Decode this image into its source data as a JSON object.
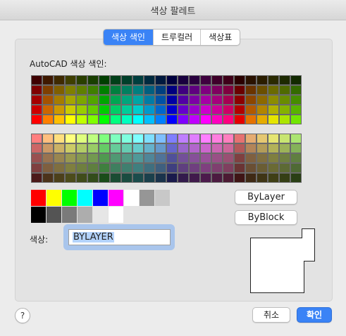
{
  "window": {
    "title": "색상 팔레트"
  },
  "tabs": [
    {
      "label": "색상 색인",
      "active": true
    },
    {
      "label": "트루컬러",
      "active": false
    },
    {
      "label": "색상표",
      "active": false
    }
  ],
  "palette": {
    "section_label": "AutoCAD 색상 색인:",
    "hue_rows": [
      [
        "#3f0000",
        "#3f1900",
        "#3f2a00",
        "#3f3f00",
        "#2a3f00",
        "#193f00",
        "#003f00",
        "#003f19",
        "#003f2a",
        "#003f3f",
        "#002a3f",
        "#00193f",
        "#00003f",
        "#19003f",
        "#2a003f",
        "#3f003f",
        "#3f002a",
        "#3f0019",
        "#2a0000",
        "#2a1200",
        "#2a1d00",
        "#2a2a00",
        "#1d2a00",
        "#122a00"
      ],
      [
        "#7f0000",
        "#7f3f00",
        "#7f5f00",
        "#7f7f00",
        "#5f7f00",
        "#3f7f00",
        "#007f00",
        "#007f3f",
        "#007f5f",
        "#007f7f",
        "#005f7f",
        "#003f7f",
        "#00007f",
        "#3f007f",
        "#5f007f",
        "#7f007f",
        "#7f005f",
        "#7f003f",
        "#6a0000",
        "#6a3400",
        "#6a4f00",
        "#6a6a00",
        "#4f6a00",
        "#346a00"
      ],
      [
        "#a50000",
        "#a55200",
        "#a57c00",
        "#a5a500",
        "#7ca500",
        "#52a500",
        "#00a500",
        "#00a552",
        "#00a57c",
        "#00a5a5",
        "#007ca5",
        "#0052a5",
        "#0000a5",
        "#5200a5",
        "#7c00a5",
        "#a500a5",
        "#a5007c",
        "#a50052",
        "#8c0000",
        "#8c4600",
        "#8c6900",
        "#8c8c00",
        "#698c00",
        "#468c00"
      ],
      [
        "#cc0000",
        "#cc6600",
        "#cc9900",
        "#cccc00",
        "#99cc00",
        "#66cc00",
        "#00cc00",
        "#00cc66",
        "#00cc99",
        "#00cccc",
        "#0099cc",
        "#0066cc",
        "#0000cc",
        "#6600cc",
        "#9900cc",
        "#cc00cc",
        "#cc0099",
        "#cc0066",
        "#b20000",
        "#b25900",
        "#b28500",
        "#b2b200",
        "#85b200",
        "#59b200"
      ],
      [
        "#ff0000",
        "#ff7f00",
        "#ffbf00",
        "#ffff00",
        "#bfff00",
        "#7fff00",
        "#00ff00",
        "#00ff7f",
        "#00ffbf",
        "#00ffff",
        "#00bfff",
        "#007fff",
        "#0000ff",
        "#7f00ff",
        "#bf00ff",
        "#ff00ff",
        "#ff00bf",
        "#ff007f",
        "#e50000",
        "#e57200",
        "#e5ac00",
        "#e5e500",
        "#ace500",
        "#72e500"
      ]
    ],
    "pastel_rows": [
      [
        "#ff7f7f",
        "#ffbf7f",
        "#ffdf7f",
        "#ffff7f",
        "#dfff7f",
        "#bfff7f",
        "#7fff7f",
        "#7fffbf",
        "#7fffdf",
        "#7fffff",
        "#7fdfff",
        "#7fbfff",
        "#7f7fff",
        "#bf7fff",
        "#df7fff",
        "#ff7fff",
        "#ff7fdf",
        "#ff7fbf",
        "#e57272",
        "#e5ac72",
        "#e5c872",
        "#e5e572",
        "#c8e572",
        "#ace572"
      ],
      [
        "#cc6666",
        "#cc9966",
        "#ccb266",
        "#cccc66",
        "#b2cc66",
        "#99cc66",
        "#66cc66",
        "#66cc99",
        "#66ccb2",
        "#66cccc",
        "#66b2cc",
        "#6699cc",
        "#6666cc",
        "#9966cc",
        "#b266cc",
        "#cc66cc",
        "#cc66b2",
        "#cc6699",
        "#b25959",
        "#b28559",
        "#b29c59",
        "#b2b259",
        "#9cb259",
        "#85b259"
      ],
      [
        "#995050",
        "#997350",
        "#998650",
        "#999950",
        "#869950",
        "#739950",
        "#509950",
        "#509973",
        "#509986",
        "#509999",
        "#508699",
        "#507399",
        "#505099",
        "#735099",
        "#865099",
        "#995099",
        "#995086",
        "#995073",
        "#7f4040",
        "#7f6040",
        "#7f6f40",
        "#7f7f40",
        "#6f7f40",
        "#607f40"
      ],
      [
        "#7f3f3f",
        "#7f5f3f",
        "#7f6f3f",
        "#7f7f3f",
        "#6f7f3f",
        "#5f7f3f",
        "#3f7f3f",
        "#3f7f5f",
        "#3f7f6f",
        "#3f7f7f",
        "#3f6f7f",
        "#3f5f7f",
        "#3f3f7f",
        "#5f3f7f",
        "#6f3f7f",
        "#7f3f7f",
        "#7f3f6f",
        "#7f3f5f",
        "#6a3434",
        "#6a4f34",
        "#6a5d34",
        "#6a6a34",
        "#5d6a34",
        "#4f6a34"
      ],
      [
        "#4c1a1a",
        "#4c331a",
        "#4c401a",
        "#4c4c1a",
        "#404c1a",
        "#334c1a",
        "#1a4c1a",
        "#1a4c33",
        "#1a4c40",
        "#1a4c4c",
        "#1a404c",
        "#1a334c",
        "#1a1a4c",
        "#331a4c",
        "#401a4c",
        "#4c1a4c",
        "#4c1a40",
        "#4c1a33",
        "#3f1515",
        "#3f2a15",
        "#3f3515",
        "#3f3f15",
        "#353f15",
        "#2a3f15"
      ]
    ],
    "standard_colors": [
      "#ff0000",
      "#ffff00",
      "#00ff00",
      "#00ffff",
      "#0000ff",
      "#ff00ff",
      "#ffffff",
      "#969696",
      "#c8c8c8"
    ],
    "gray_colors": [
      "#000000",
      "#545454",
      "#7a7a7a",
      "#adadad",
      "#e6e6e6",
      "#ffffff"
    ]
  },
  "buttons": {
    "bylayer": "ByLayer",
    "byblock": "ByBlock",
    "help": "?",
    "cancel": "취소",
    "ok": "확인"
  },
  "color_field": {
    "label": "색상:",
    "value": "BYLAYER"
  }
}
